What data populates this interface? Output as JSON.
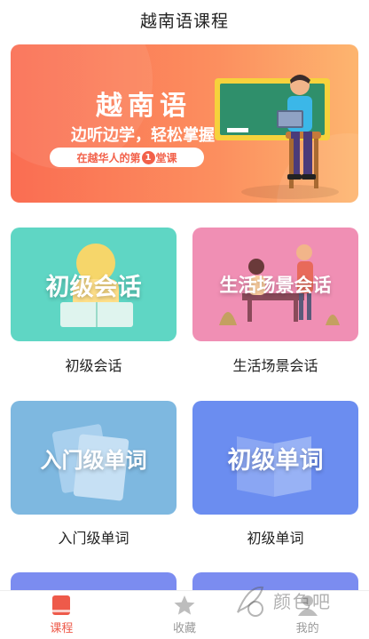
{
  "header": {
    "title": "越南语课程"
  },
  "banner": {
    "title": "越南语",
    "subtitle": "边听边学，轻松掌握",
    "pill_prefix": "在越华人的第",
    "pill_number": "1",
    "pill_suffix": "堂课"
  },
  "courses": [
    {
      "name": "初级会话",
      "card_text": "初级会话",
      "color": "#5fd6c4"
    },
    {
      "name": "生活场景会话",
      "card_text": "生活场景会话",
      "color": "#f08fb4"
    },
    {
      "name": "入门级单词",
      "card_text": "入门级单词",
      "color": "#7eb8e0"
    },
    {
      "name": "初级单词",
      "card_text": "初级单词",
      "color": "#6b8df0"
    }
  ],
  "tabbar": {
    "items": [
      {
        "label": "课程",
        "icon": "book-icon",
        "active": true
      },
      {
        "label": "收藏",
        "icon": "star-icon",
        "active": false
      },
      {
        "label": "我的",
        "icon": "user-icon",
        "active": false
      }
    ],
    "active_color": "#ee5a4a",
    "inactive_color": "#999999"
  },
  "watermark": {
    "text": "颜色吧"
  }
}
